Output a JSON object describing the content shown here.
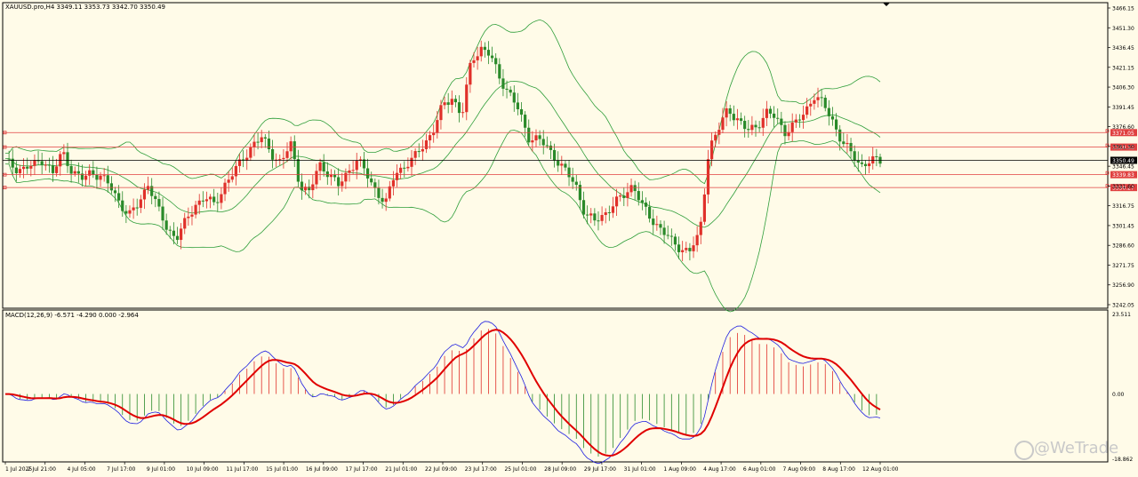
{
  "main_header": "XAUUSD.pro,H4  3349.11 3353.73 3342.70 3350.49",
  "macd_header": "MACD(12,26,9) -6.571 -4.290 0.000 -2.964",
  "watermark": "@WeTrade",
  "colors": {
    "background": "#fffbe8",
    "bull": "#e0302a",
    "bear": "#2a8a2a",
    "bands": "#2f9e3a",
    "hline": "#e04040",
    "macd_main": "#e00000",
    "macd_signal": "#2020e0"
  },
  "chart_data": [
    {
      "type": "candlestick",
      "symbol": "XAUUSD.pro",
      "timeframe": "H4",
      "ylim": [
        3242.05,
        3466.15
      ],
      "price_ticks": [
        "3466.15",
        "3451.30",
        "3436.45",
        "3421.15",
        "3406.30",
        "3391.45",
        "3376.60",
        "3361.30",
        "3346.45",
        "3331.60",
        "3316.75",
        "3301.45",
        "3286.60",
        "3271.75",
        "3256.90",
        "3242.05"
      ],
      "current_price": "3350.49",
      "horizontal_lines": [
        {
          "label": "3371.05",
          "value": 3371.05
        },
        {
          "label": "3360.30",
          "value": 3360.3
        },
        {
          "label": "3339.83",
          "value": 3339.83
        },
        {
          "label": "3330.27",
          "value": 3330.27
        }
      ],
      "time_labels": [
        "1 Jul 2025",
        "2 Jul 21:00",
        "4 Jul 05:00",
        "7 Jul 17:00",
        "9 Jul 01:00",
        "10 Jul 09:00",
        "11 Jul 17:00",
        "15 Jul 01:00",
        "16 Jul 09:00",
        "17 Jul 17:00",
        "21 Jul 01:00",
        "22 Jul 09:00",
        "23 Jul 17:00",
        "25 Jul 01:00",
        "28 Jul 09:00",
        "29 Jul 17:00",
        "31 Jul 01:00",
        "1 Aug 09:00",
        "4 Aug 17:00",
        "6 Aug 01:00",
        "7 Aug 09:00",
        "8 Aug 17:00",
        "12 Aug 01:00"
      ],
      "close_path": [
        3350,
        3345,
        3344,
        3347,
        3352,
        3340,
        3357,
        3343,
        3336,
        3342,
        3339,
        3331,
        3320,
        3309,
        3318,
        3334,
        3315,
        3300,
        3293,
        3305,
        3318,
        3323,
        3317,
        3332,
        3341,
        3352,
        3362,
        3367,
        3356,
        3348,
        3363,
        3332,
        3326,
        3348,
        3341,
        3331,
        3342,
        3351,
        3340,
        3328,
        3318,
        3342,
        3346,
        3352,
        3363,
        3372,
        3391,
        3398,
        3382,
        3425,
        3434,
        3428,
        3412,
        3400,
        3387,
        3368,
        3366,
        3360,
        3351,
        3341,
        3332,
        3310,
        3305,
        3311,
        3318,
        3324,
        3333,
        3316,
        3306,
        3300,
        3290,
        3285,
        3284,
        3294,
        3360,
        3373,
        3389,
        3381,
        3372,
        3376,
        3386,
        3382,
        3372,
        3377,
        3385,
        3399,
        3392,
        3380,
        3364,
        3355,
        3347,
        3350,
        3350
      ]
    },
    {
      "type": "bar",
      "indicator": "MACD(12,26,9)",
      "ylim": [
        -18.862,
        23.511
      ],
      "value_ticks": [
        "23.511",
        "0.00",
        "-18.862"
      ],
      "values": {
        "macd": -6.571,
        "signal": -4.29,
        "value3": 0.0,
        "value4": -2.964
      }
    }
  ]
}
